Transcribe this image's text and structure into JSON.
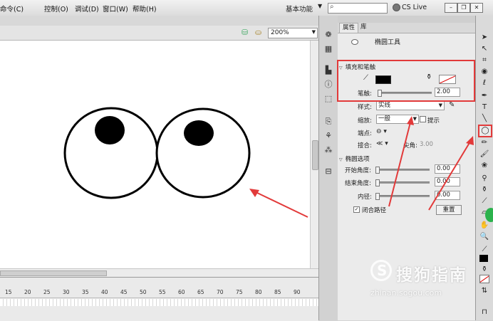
{
  "menubar": {
    "items": [
      "命令(C)",
      "控制(O)",
      "调试(D)",
      "窗口(W)",
      "帮助(H)"
    ],
    "workspace": "基本功能",
    "cslive": "CS Live"
  },
  "stage": {
    "zoom": "200%"
  },
  "timeline": {
    "ticks": [
      "15",
      "20",
      "25",
      "30",
      "35",
      "40",
      "45",
      "50",
      "55",
      "60",
      "65",
      "70",
      "75",
      "80",
      "85",
      "90"
    ]
  },
  "panel": {
    "tab_properties": "属性",
    "tab_library": "库",
    "tool_name": "椭圆工具",
    "fill_stroke_section": "填充和笔触",
    "stroke_label": "笔触:",
    "stroke_value": "2.00",
    "style_label": "样式:",
    "style_value": "实线",
    "scale_label": "缩放:",
    "scale_value": "一般",
    "hint_label": "提示",
    "cap_label": "端点:",
    "join_label": "接合:",
    "miter_label": "尖角:",
    "miter_value": "3.00",
    "oval_section": "椭圆选项",
    "start_angle_label": "开始角度:",
    "start_angle_value": "0.00",
    "end_angle_label": "结束角度:",
    "end_angle_value": "0.00",
    "inner_radius_label": "内径:",
    "inner_radius_value": "0.00",
    "close_path_label": "闭合路径",
    "reset_label": "重置"
  },
  "watermark": {
    "main": "搜狗指南",
    "sub": "zhinan.sogou.com",
    "letter": "S"
  },
  "colors": {
    "annotation_red": "#e23a3a",
    "stroke_color": "#000000"
  },
  "icons": [
    "search-icon",
    "oval-tool-icon",
    "selection-tool-icon",
    "text-tool-icon",
    "info-icon",
    "transform-icon"
  ]
}
